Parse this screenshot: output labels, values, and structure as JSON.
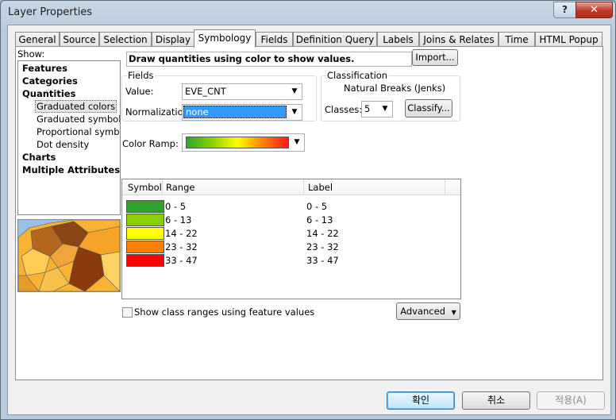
{
  "window": {
    "title": "Layer Properties",
    "help_label": "?",
    "close_label": "✕"
  },
  "tabs": [
    {
      "label": "General"
    },
    {
      "label": "Source"
    },
    {
      "label": "Selection"
    },
    {
      "label": "Display"
    },
    {
      "label": "Symbology",
      "active": true
    },
    {
      "label": "Fields"
    },
    {
      "label": "Definition Query"
    },
    {
      "label": "Labels"
    },
    {
      "label": "Joins & Relates"
    },
    {
      "label": "Time"
    },
    {
      "label": "HTML Popup"
    }
  ],
  "show": {
    "label": "Show:",
    "items": [
      {
        "label": "Features",
        "bold": true
      },
      {
        "label": "Categories",
        "bold": true
      },
      {
        "label": "Quantities",
        "bold": true
      },
      {
        "label": "Graduated colors",
        "selected": true
      },
      {
        "label": "Graduated symbols"
      },
      {
        "label": "Proportional symbols"
      },
      {
        "label": "Dot density"
      },
      {
        "label": "Charts",
        "bold": true
      },
      {
        "label": "Multiple Attributes",
        "bold": true
      }
    ]
  },
  "description": "Draw quantities using color to show values.",
  "import_label": "Import...",
  "fields": {
    "group_label": "Fields",
    "value_label": "Value:",
    "value": "EVE_CNT",
    "normalization_label": "Normalization:",
    "normalization": "none"
  },
  "classification": {
    "group_label": "Classification",
    "method": "Natural Breaks (Jenks)",
    "classes_label": "Classes:",
    "classes": "5",
    "classify_label": "Classify..."
  },
  "color_ramp_label": "Color Ramp:",
  "table": {
    "headers": {
      "symbol": "Symbol",
      "range": "Range",
      "label": "Label"
    },
    "rows": [
      {
        "color": "#2ea22e",
        "range": "0 - 5",
        "label": "0 - 5"
      },
      {
        "color": "#8ccf00",
        "range": "6 - 13",
        "label": "6 - 13"
      },
      {
        "color": "#ffff00",
        "range": "14 - 22",
        "label": "14 - 22"
      },
      {
        "color": "#ff8000",
        "range": "23 - 32",
        "label": "23 - 32"
      },
      {
        "color": "#ff0000",
        "range": "33 - 47",
        "label": "33 - 47"
      }
    ]
  },
  "show_ranges_label": "Show class ranges using feature values",
  "advanced_label": "Advanced",
  "buttons": {
    "ok": "확인",
    "cancel": "취소",
    "apply": "적용(A)"
  }
}
